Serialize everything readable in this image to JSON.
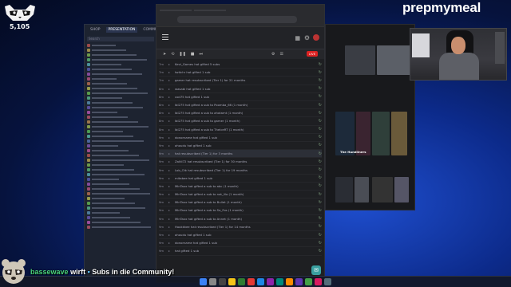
{
  "overlay": {
    "counter": "5,105",
    "brand": "prepmymeal",
    "alert": {
      "username": "bassewave",
      "message_1": "wirft",
      "message_2": "Subs in die Community!"
    }
  },
  "left_window": {
    "tabs": [
      "SHOP",
      "PRESENTATION",
      "COMMUNITY"
    ],
    "active_tab": 1,
    "search_label": "Search",
    "rows": [
      "",
      "",
      "",
      "",
      "",
      "",
      "",
      "",
      "",
      "",
      "",
      "",
      "",
      "",
      "",
      "",
      "",
      "",
      "",
      "",
      "",
      "",
      "",
      "",
      "",
      "",
      "",
      "",
      "",
      "",
      "",
      "",
      "",
      "",
      "",
      "",
      "",
      "",
      ""
    ]
  },
  "main_window": {
    "live_label": "LIVE",
    "feed": [
      {
        "time": "7m",
        "text": "Kevi_Games hat gifted 5 subs",
        "hl": false
      },
      {
        "time": "7m",
        "text": "twitchr hat gifted 1 sub",
        "hl": false
      },
      {
        "time": "7m",
        "text": "gamer hat resubscribed (Tier 1) for 21 months",
        "hl": false
      },
      {
        "time": "8m",
        "text": "wasabi hat gifted 1 sub",
        "hl": false
      },
      {
        "time": "8m",
        "text": "cod75 hat gifted 1 sub",
        "hl": false
      },
      {
        "time": "8m",
        "text": "lbl275 hat gifted a sub to Poomba_66 (1 month)",
        "hl": false
      },
      {
        "time": "8m",
        "text": "lbl275 hat gifted a sub to ahotamt (1 month)",
        "hl": false
      },
      {
        "time": "8m",
        "text": "lbl275 hat gifted a sub to gamer (1 month)",
        "hl": false
      },
      {
        "time": "8m",
        "text": "lbl275 hat gifted a sub to TheIceRT (1 month)",
        "hl": false
      },
      {
        "time": "9m",
        "text": "donorname hat gifted 1 sub",
        "hl": false
      },
      {
        "time": "9m",
        "text": "ahoudu hat gifted 1 sub",
        "hl": false
      },
      {
        "time": "9m",
        "text": "hat resubscribed (Tier 1) for 3 months",
        "hl": true
      },
      {
        "time": "9m",
        "text": "Zaltil72 hat resubscribed (Tier 1) for 30 months",
        "hl": false
      },
      {
        "time": "9m",
        "text": "Lob_Oik hat resubscribed (Tier 1) for 19 months",
        "hl": false
      },
      {
        "time": "9m",
        "text": "mitabee hat gifted 1 sub",
        "hl": false
      },
      {
        "time": "9m",
        "text": "MInTaxx hat gifted a sub to abc (1 month)",
        "hl": false
      },
      {
        "time": "9m",
        "text": "MInTaxx hat gifted a sub to nat_lilo (1 month)",
        "hl": false
      },
      {
        "time": "9m",
        "text": "MInTaxx hat gifted a sub to Bullet (1 month)",
        "hl": false
      },
      {
        "time": "9m",
        "text": "MInTaxx hat gifted a sub to Sa_Fos (1 month)",
        "hl": false
      },
      {
        "time": "9m",
        "text": "MInTaxx hat gifted a sub to Annet (1 month)",
        "hl": false
      },
      {
        "time": "9m",
        "text": "Hookkkee hat resubscribed (Tier 1) for 14 months",
        "hl": false
      },
      {
        "time": "9m",
        "text": "ahoudu hat gifted 1 sub",
        "hl": false
      },
      {
        "time": "9m",
        "text": "donorname hat gifted 1 sub",
        "hl": false
      },
      {
        "time": "9m",
        "text": "hat gifted 1 sub",
        "hl": false
      }
    ]
  },
  "right_window": {
    "row_title_1": "",
    "row_title_2": "",
    "thumb_label_1": "The Hundliners"
  },
  "taskbar": {
    "time": "",
    "date": ""
  },
  "colors": {
    "live": "#dd2222",
    "alert_user": "#49d27a",
    "desktop_blue": "#1f4fd0"
  }
}
